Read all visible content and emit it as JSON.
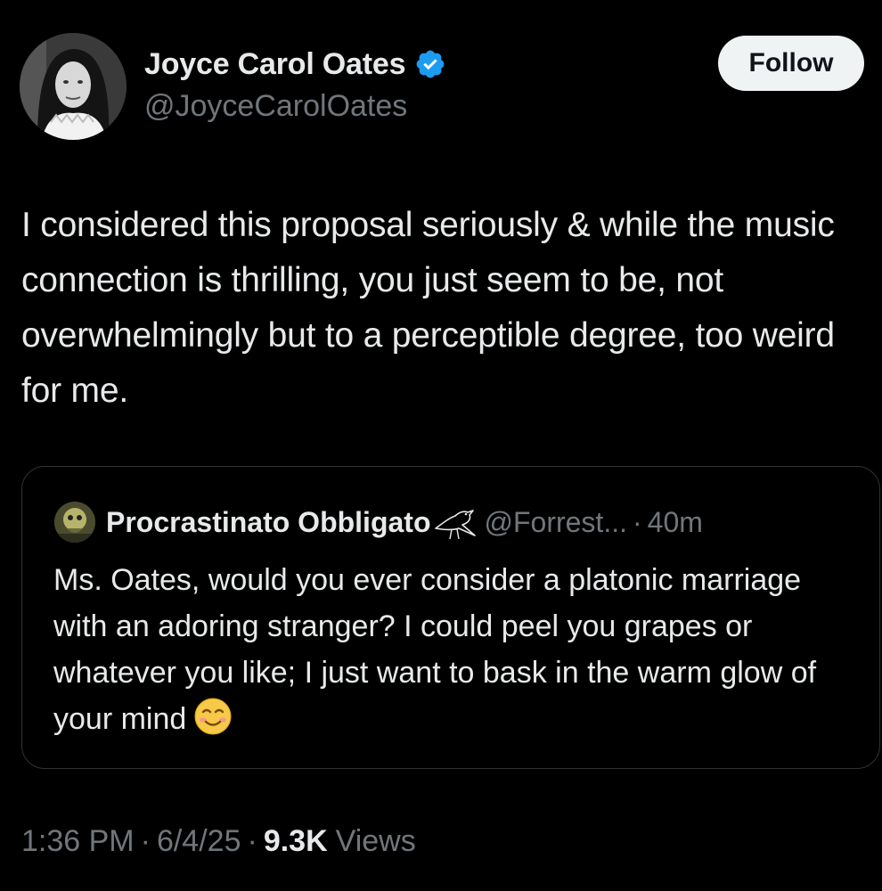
{
  "author": {
    "name": "Joyce Carol Oates",
    "handle": "@JoyceCarolOates",
    "verified": true,
    "verified_color": "#1d9bf0"
  },
  "follow_label": "Follow",
  "tweet": {
    "text": "I considered this proposal seriously & while the music connection is thrilling, you just seem to be, not overwhelmingly but to a perceptible degree, too weird for me."
  },
  "quote": {
    "name": "Procrastinato Obbligato",
    "name_icon": "bird-icon",
    "handle": "@Forrest...",
    "separator": "·",
    "time": "40m",
    "text": "Ms. Oates, would you ever consider a platonic marriage with an adoring stranger? I could peel you grapes or whatever you like; I just want to bask in the warm glow of your mind",
    "emoji": "smiling-face-icon"
  },
  "meta": {
    "time": "1:36 PM",
    "separator": "·",
    "date": "6/4/25",
    "views_count": "9.3K",
    "views_label": "Views"
  },
  "colors": {
    "background": "#000000",
    "text_primary": "#e7e9ea",
    "text_secondary": "#71767b",
    "border": "#2f3336",
    "follow_bg": "#eff3f4"
  }
}
